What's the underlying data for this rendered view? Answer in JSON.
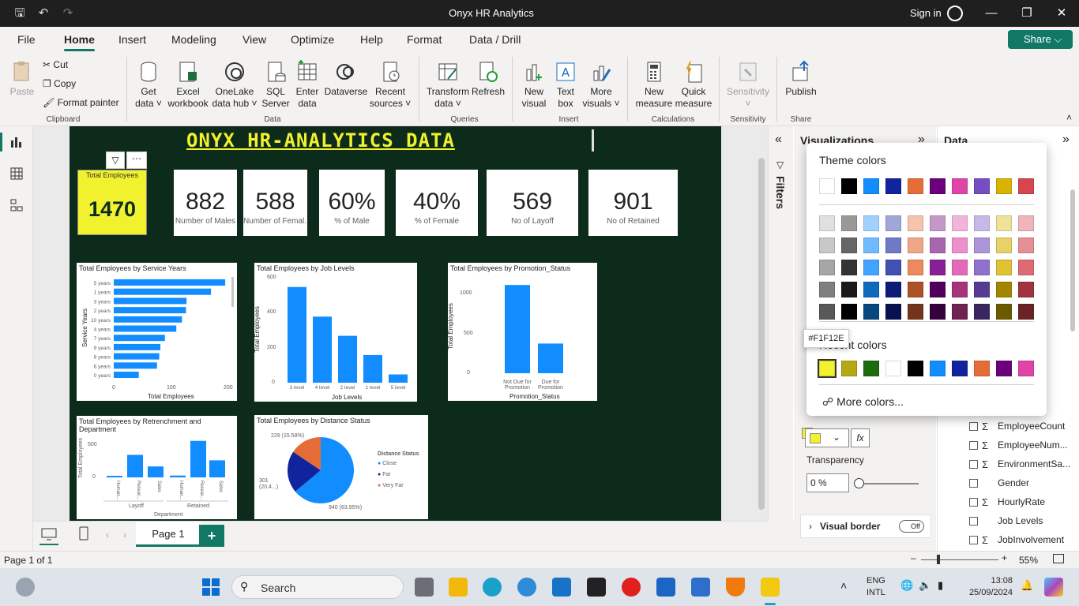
{
  "app": {
    "title": "Onyx HR Analytics",
    "signin": "Sign in"
  },
  "menu": [
    "File",
    "Home",
    "Insert",
    "Modeling",
    "View",
    "Optimize",
    "Help",
    "Format",
    "Data / Drill"
  ],
  "share_label": "Share",
  "ribbon": {
    "paste": "Paste",
    "cut": "Cut",
    "copy": "Copy",
    "format_painter": "Format painter",
    "get_data": "Get",
    "get_data2": "data",
    "excel": "Excel",
    "excel2": "workbook",
    "onelake": "OneLake",
    "onelake2": "data hub",
    "sql": "SQL",
    "sql2": "Server",
    "enter": "Enter",
    "enter2": "data",
    "dataverse": "Dataverse",
    "recent": "Recent",
    "recent2": "sources",
    "transform": "Transform",
    "transform2": "data",
    "refresh": "Refresh",
    "new_visual": "New",
    "new_visual2": "visual",
    "textbox": "Text",
    "textbox2": "box",
    "more_visuals": "More",
    "more_visuals2": "visuals",
    "new_measure": "New",
    "new_measure2": "measure",
    "quick_measure": "Quick",
    "quick_measure2": "measure",
    "sensitivity": "Sensitivity",
    "publish": "Publish",
    "groups": {
      "clipboard": "Clipboard",
      "data": "Data",
      "queries": "Queries",
      "insert": "Insert",
      "calculations": "Calculations",
      "sensitivity": "Sensitivity",
      "share": "Share"
    }
  },
  "report": {
    "title": "ONYX HR-ANALYTICS DATA",
    "total_card": {
      "label": "Total Employees",
      "value": "1470",
      "bg": "#F1F12E"
    },
    "cards": [
      {
        "value": "882",
        "label": "Number of Males"
      },
      {
        "value": "588",
        "label": "Number of Femal..."
      },
      {
        "value": "60%",
        "label": "% of Male"
      },
      {
        "value": "40%",
        "label": "% of Female"
      },
      {
        "value": "569",
        "label": "No of Layoff"
      },
      {
        "value": "901",
        "label": "No of Retained"
      }
    ]
  },
  "chart_data": [
    {
      "type": "bar",
      "title": "Total Employees by Service Years",
      "orientation": "horizontal",
      "categories": [
        "5 years",
        "1 years",
        "3 years",
        "2 years",
        "10 years",
        "4 years",
        "7 years",
        "9 years",
        "8 years",
        "6 years",
        "0 years"
      ],
      "values": [
        196,
        171,
        128,
        127,
        120,
        110,
        90,
        82,
        80,
        76,
        44
      ],
      "xlabel": "Total Employees",
      "ylabel": "Service Years",
      "xticks": [
        "0",
        "100",
        "200"
      ],
      "xlim": [
        0,
        200
      ]
    },
    {
      "type": "bar",
      "title": "Total Employees by Job Levels",
      "categories": [
        "3 level",
        "4 level",
        "2 level",
        "1 level",
        "5 level"
      ],
      "values": [
        543,
        375,
        266,
        157,
        47
      ],
      "xlabel": "Job Levels",
      "ylabel": "Total Employees",
      "yticks": [
        "0",
        "200",
        "400",
        "600"
      ],
      "ylim": [
        0,
        600
      ]
    },
    {
      "type": "bar",
      "title": "Total Employees by Promotion_Status",
      "categories": [
        "Not Due for Promotion",
        "Due for Promotion"
      ],
      "values": [
        1100,
        370
      ],
      "xlabel": "Promotion_Status",
      "ylabel": "Total Employees",
      "yticks": [
        "0",
        "500",
        "1000"
      ],
      "ylim": [
        0,
        1200
      ]
    },
    {
      "type": "bar",
      "title": "Total Employees by Retrenchment and Department",
      "groups": [
        "Layoff",
        "Retained"
      ],
      "categories": [
        "Human...",
        "Resear...",
        "Sales",
        "Human...",
        "Resear...",
        "Sales"
      ],
      "values": [
        20,
        370,
        180,
        30,
        600,
        280
      ],
      "xlabel": "Department",
      "ylabel": "Total Employees",
      "yticks": [
        "0",
        "500"
      ],
      "ylim": [
        0,
        700
      ]
    },
    {
      "type": "pie",
      "title": "Total Employees by Distance Status",
      "legend_title": "Distance Status",
      "slices": [
        {
          "name": "Close",
          "value": 940,
          "label": "940 (63.95%)",
          "color": "#118DFF"
        },
        {
          "name": "Far",
          "value": 301,
          "label": "301 (20.4...)",
          "color": "#12239E"
        },
        {
          "name": "Very Far",
          "value": 229,
          "label": "229 (15.58%)",
          "color": "#E66C37"
        }
      ]
    }
  ],
  "picker": {
    "theme_title": "Theme colors",
    "recent_title": "Recent colors",
    "tooltip": "#F1F12E",
    "more": "More colors...",
    "theme": [
      "#FFFFFF",
      "#000000",
      "#118DFF",
      "#12239E",
      "#E66C37",
      "#6B007B",
      "#E044A7",
      "#744EC2",
      "#D9B300",
      "#D64550"
    ],
    "shades": [
      [
        "#E0E0E0",
        "#999999",
        "#A0D1FF",
        "#A0A7D8",
        "#F5C4AF",
        "#C499CA",
        "#F3B4DC",
        "#C7B8E7",
        "#F0E199",
        "#EFB5B9"
      ],
      [
        "#C8C8C8",
        "#666666",
        "#70BBFF",
        "#7079C5",
        "#F0A787",
        "#A666B0",
        "#EC8FCA",
        "#AC95DA",
        "#E8D166",
        "#E68F96"
      ],
      [
        "#A6A6A6",
        "#333333",
        "#41A4FF",
        "#4150B1",
        "#EB895F",
        "#891F95",
        "#E669B9",
        "#9071CE",
        "#E1C233",
        "#DE6A73"
      ],
      [
        "#7F7F7F",
        "#1A1A1A",
        "#0D6ABF",
        "#0E1A77",
        "#AD5129",
        "#50005C",
        "#A8337D",
        "#573B92",
        "#A38600",
        "#A1343C"
      ],
      [
        "#595959",
        "#000000",
        "#094780",
        "#09124F",
        "#73361C",
        "#36003E",
        "#702253",
        "#3A2761",
        "#6D5A00",
        "#6B2328"
      ]
    ],
    "recent": [
      "#F1F12E",
      "#B5A814",
      "#1C6B0F",
      "#FFFFFF",
      "#000000",
      "#118DFF",
      "#12239E",
      "#E66C37",
      "#6B007B",
      "#E044A7"
    ]
  },
  "viz_pane": {
    "title": "Visualizations",
    "transparency_label": "Transparency",
    "transparency_value": "0 %",
    "visual_border": "Visual border",
    "off": "Off",
    "fx": "fx"
  },
  "filters_label": "Filters",
  "data_pane": {
    "title": "Data",
    "fields": [
      {
        "name": "EmployeeCount",
        "sigma": true
      },
      {
        "name": "EmployeeNum...",
        "sigma": true
      },
      {
        "name": "EnvironmentSa...",
        "sigma": true
      },
      {
        "name": "Gender",
        "sigma": false
      },
      {
        "name": "HourlyRate",
        "sigma": true
      },
      {
        "name": "Job Levels",
        "sigma": false
      },
      {
        "name": "JobInvolvement",
        "sigma": true
      }
    ]
  },
  "page_tab": "Page 1",
  "status": {
    "page": "Page 1 of 1",
    "zoom": "55%"
  },
  "taskbar": {
    "search": "Search",
    "lang1": "ENG",
    "lang2": "INTL",
    "time": "13:08",
    "date": "25/09/2024"
  }
}
